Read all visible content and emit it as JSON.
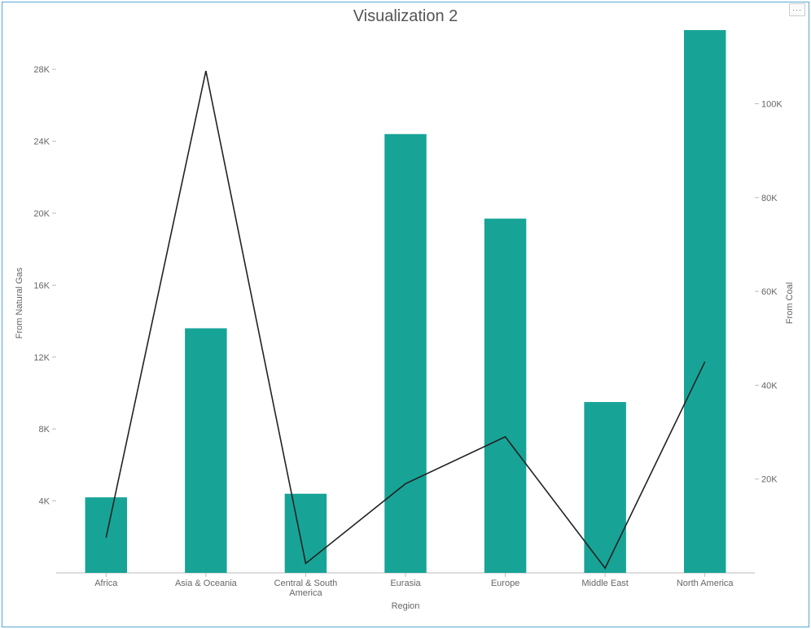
{
  "title": "Visualization 2",
  "more_button_name": "more-options",
  "chart_data": {
    "type": "bar+line",
    "categories": [
      "Africa",
      "Asia & Oceania",
      "Central & South America",
      "Eurasia",
      "Europe",
      "Middle East",
      "North America"
    ],
    "xlabel": "Region",
    "left_axis": {
      "label": "From Natural Gas",
      "min": 0,
      "max": 30000,
      "ticks": [
        4000,
        8000,
        12000,
        16000,
        20000,
        24000,
        28000
      ],
      "tick_labels": [
        "4K",
        "8K",
        "12K",
        "16K",
        "20K",
        "24K",
        "28K"
      ]
    },
    "right_axis": {
      "label": "From Coal",
      "min": 0,
      "max": 115000,
      "ticks": [
        20000,
        40000,
        60000,
        80000,
        100000
      ],
      "tick_labels": [
        "20K",
        "40K",
        "60K",
        "80K",
        "100K"
      ]
    },
    "series": [
      {
        "name": "From Natural Gas",
        "type": "bar",
        "axis": "left",
        "values": [
          4200,
          13600,
          4400,
          24400,
          19700,
          9500,
          30300
        ]
      },
      {
        "name": "From Coal",
        "type": "line",
        "axis": "right",
        "values": [
          7500,
          107000,
          2000,
          19000,
          29000,
          1000,
          45000
        ]
      }
    ]
  }
}
